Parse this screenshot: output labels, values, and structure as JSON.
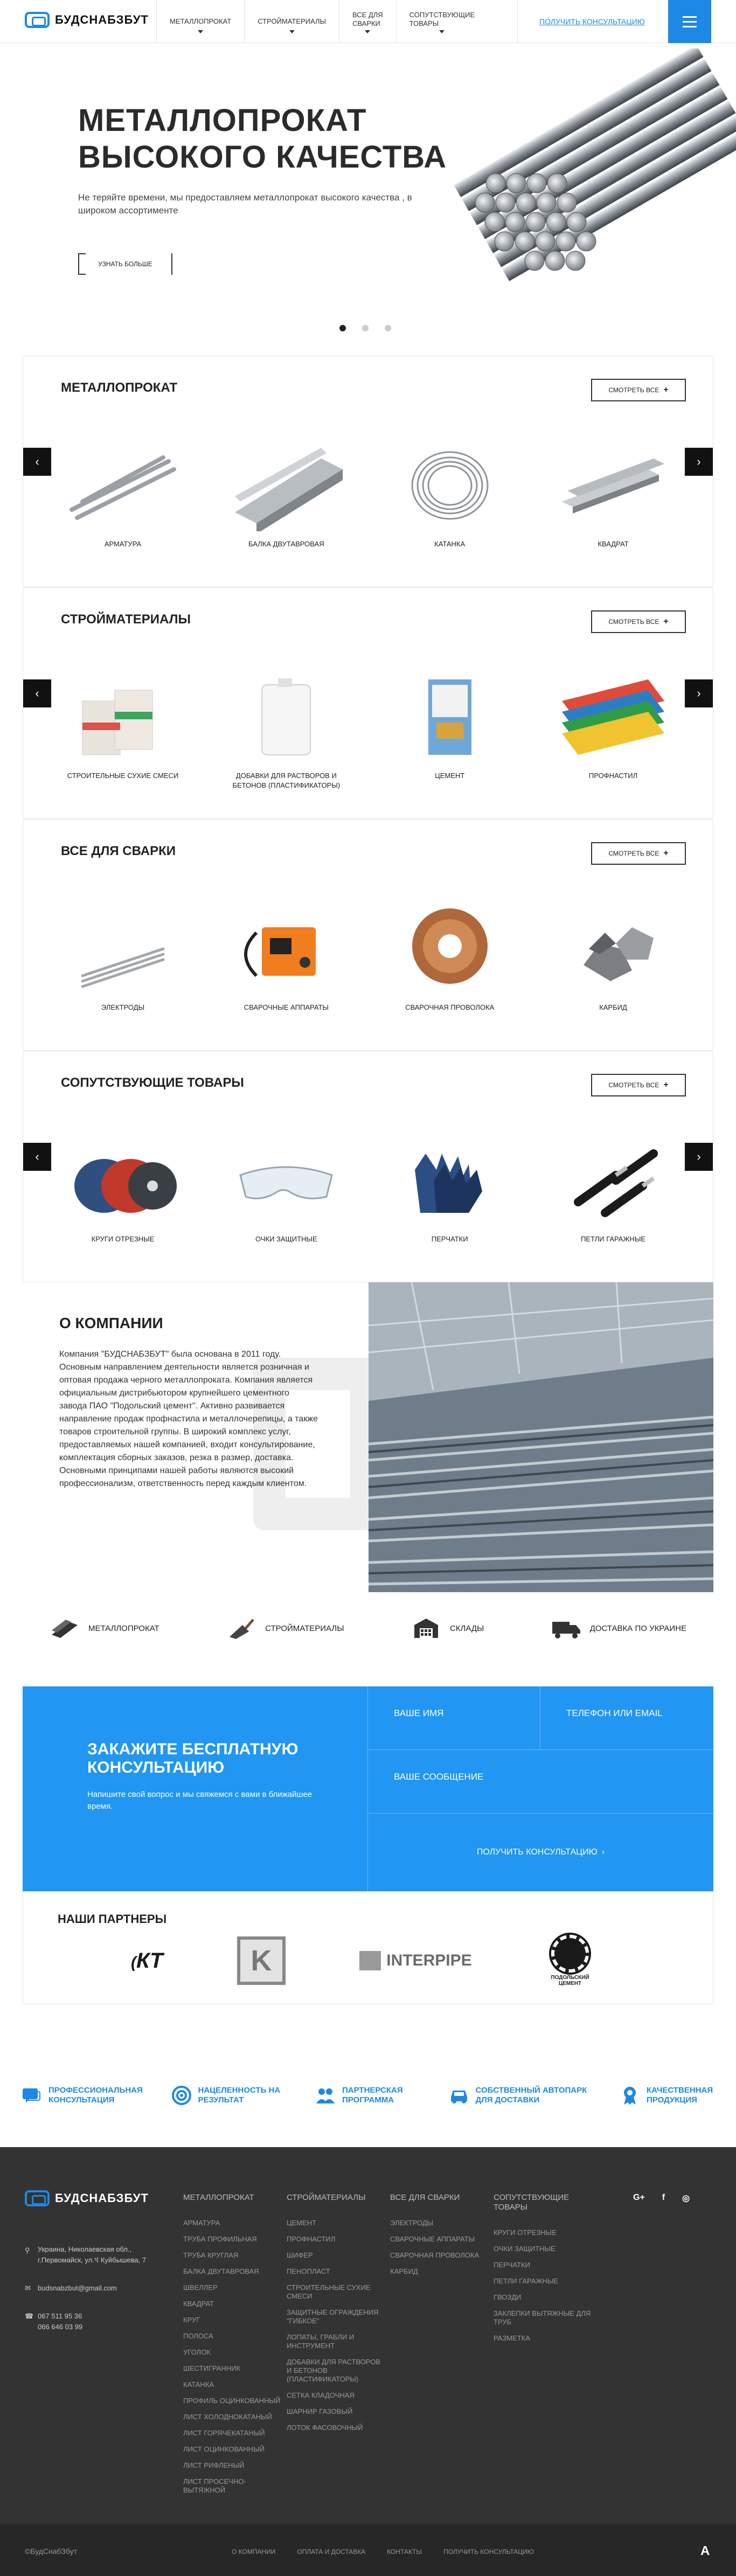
{
  "header": {
    "logo": "БУДСНАБЗБУТ",
    "nav": [
      "МЕТАЛЛОПРОКАТ",
      "СТРОЙМАТЕРИАЛЫ",
      "ВСЕ ДЛЯ\nСВАРКИ",
      "СОПУТСТВУЮЩИЕ\nТОВАРЫ"
    ],
    "consult": "ПОЛУЧИТЬ КОНСУЛЬТАЦИЮ"
  },
  "hero": {
    "title_line1": "МЕТАЛЛОПРОКАТ",
    "title_line2": "ВЫСОКОГО КАЧЕСТВА",
    "subtitle": "Не теряйте времени, мы предоставляем металлопрокат высокого качества , в широком ассортименте",
    "button": "УЗНАТЬ БОЛЬШЕ",
    "slides": 3,
    "active_slide": 1
  },
  "see_all": "СМОТРЕТЬ ВСЕ",
  "categories": [
    {
      "title": "МЕТАЛЛОПРОКАТ",
      "products": [
        "АРМАТУРА",
        "БАЛКА ДВУТАВРОВАЯ",
        "КАТАНКА",
        "КВАДРАТ"
      ]
    },
    {
      "title": "СТРОЙМАТЕРИАЛЫ",
      "products": [
        "СТРОИТЕЛЬНЫЕ СУХИЕ СМЕСИ",
        "ДОБАВКИ ДЛЯ РАСТВОРОВ И БЕТОНОВ (ПЛАСТИФИКАТОРЫ)",
        "ЦЕМЕНТ",
        "ПРОФНАСТИЛ"
      ]
    },
    {
      "title": "ВСЕ ДЛЯ СВАРКИ",
      "products": [
        "ЭЛЕКТРОДЫ",
        "СВАРОЧНЫЕ АППАРАТЫ",
        "СВАРОЧНАЯ ПРОВОЛОКА",
        "КАРБИД"
      ]
    },
    {
      "title": "СОПУТСТВУЮЩИЕ ТОВАРЫ",
      "products": [
        "КРУГИ ОТРЕЗНЫЕ",
        "ОЧКИ ЗАЩИТНЫЕ",
        "ПЕРЧАТКИ",
        "ПЕТЛИ ГАРАЖНЫЕ"
      ]
    }
  ],
  "about": {
    "title": "О КОМПАНИИ",
    "text": "Компания \"БУДСНАБЗБУТ\" была основана в 2011 году. Основным направлением деятельности является розничная и оптовая продажа черного металлопроката. Компания является официальным дистрибьютором крупнейшего цементного завода ПАО \"Подольский цемент\". Активно развивается направление продаж профнастила и металлочерепицы, а также товаров строительной группы. В широкий комплекс услуг, предоставляемых нашей компанией, входит консультирование, комплектация сборных заказов, резка в размер, доставка. Основными принципами нашей работы являются высокий профессионализм, ответственность перед каждым клиентом."
  },
  "features": [
    "МЕТАЛЛОПРОКАТ",
    "СТРОЙМАТЕРИАЛЫ",
    "СКЛАДЫ",
    "ДОСТАВКА ПО УКРАИНЕ"
  ],
  "form": {
    "title": "ЗАКАЖИТЕ БЕСПЛАТНУЮ КОНСУЛЬТАЦИЮ",
    "subtitle": "Напишите свой вопрос и мы свяжемся с вами в ближайшее время.",
    "name_placeholder": "ВАШЕ ИМЯ",
    "contact_placeholder": "ТЕЛЕФОН ИЛИ EMAIL",
    "message_placeholder": "ВАШЕ СООБЩЕНИЕ",
    "submit": "ПОЛУЧИТЬ КОНСУЛЬТАЦИЮ"
  },
  "partners": {
    "title": "НАШИ ПАРТНЕРЫ",
    "logos": [
      "КТ",
      "K",
      "INTERPIPE",
      "ПОДОЛЬСКИЙ ЦЕМЕНТ"
    ]
  },
  "advantages": [
    "ПРОФЕССИОНАЛЬНАЯ КОНСУЛЬТАЦИЯ",
    "НАЦЕЛЕННОСТЬ НА РЕЗУЛЬТАТ",
    "ПАРТНЕРСКАЯ ПРОГРАММА",
    "СОБСТВЕННЫЙ АВТОПАРК ДЛЯ ДОСТАВКИ",
    "КАЧЕСТВЕННАЯ ПРОДУКЦИЯ"
  ],
  "footer": {
    "logo": "БУДСНАБЗБУТ",
    "address": "Украина, Николаевская обл., г.Первомайск, ул.থ Куйбышева, 7",
    "email": "budsnabzbut@gmail.com",
    "phone1": "067 511 95 36",
    "phone2": "066 646 03 99",
    "columns": [
      {
        "title": "МЕТАЛЛОПРОКАТ",
        "items": [
          "АРМАТУРА",
          "ТРУБА ПРОФИЛЬНАЯ",
          "ТРУБА КРУГЛАЯ",
          "БАЛКА ДВУТАВРОВАЯ",
          "ШВЕЛЛЕР",
          "КВАДРАТ",
          "КРУГ",
          "ПОЛОСА",
          "УГОЛОК",
          "ШЕСТИГРАННИК",
          "КАТАНКА",
          "ПРОФИЛЬ ОЦИНКОВАННЫЙ",
          "ЛИСТ ХОЛОДНОКАТАНЫЙ",
          "ЛИСТ ГОРЯЧЕКАТАНЫЙ",
          "ЛИСТ ОЦИНКОВАННЫЙ",
          "ЛИСТ РИФЛЕНЫЙ",
          "ЛИСТ ПРОСЕЧНО-ВЫТЯЖНОЙ"
        ]
      },
      {
        "title": "СТРОЙМАТЕРИАЛЫ",
        "items": [
          "ЦЕМЕНТ",
          "ПРОФНАСТИЛ",
          "ШИФЕР",
          "ПЕНОПЛАСТ",
          "СТРОИТЕЛЬНЫЕ СУХИЕ СМЕСИ",
          "ЗАЩИТНЫЕ ОГРАЖДЕНИЯ \"ГИБКОЕ\"",
          "ЛОПАТЫ, ГРАБЛИ И ИНСТРУМЕНТ",
          "ДОБАВКИ ДЛЯ РАСТВОРОВ И БЕТОНОВ (ПЛАСТИФИКАТОРЫ)",
          "СЕТКА КЛАДОЧНАЯ",
          "ШАРНИР ГАЗОВЫЙ",
          "ЛОТОК ФАСОВОЧНЫЙ"
        ]
      },
      {
        "title": "ВСЕ ДЛЯ СВАРКИ",
        "items": [
          "ЭЛЕКТРОДЫ",
          "СВАРОЧНЫЕ АППАРАТЫ",
          "СВАРОЧНАЯ ПРОВОЛОКА",
          "КАРБИД"
        ]
      },
      {
        "title": "СОПУТСТВУЮЩИЕ ТОВАРЫ",
        "items": [
          "КРУГИ ОТРЕЗНЫЕ",
          "ОЧКИ ЗАЩИТНЫЕ",
          "ПЕРЧАТКИ",
          "ПЕТЛИ ГАРАЖНЫЕ",
          "ГВОЗДИ",
          "ЗАКЛЕПКИ ВЫТЯЖНЫЕ ДЛЯ ТРУБ",
          "РАЗМЕТКА"
        ]
      }
    ],
    "social": [
      "G+",
      "f",
      "◎"
    ],
    "copyright": "©БудСнабЗбут",
    "bottom_links": [
      "О КОМПАНИИ",
      "ОПЛАТА И ДОСТАВКА",
      "КОНТАКТЫ",
      "ПОЛУЧИТЬ КОНСУЛЬТАЦИЮ"
    ],
    "font_toggle": "A"
  },
  "colors": {
    "accent": "#1e88e5",
    "form_bg": "#2196f3",
    "footer_bg": "#333333"
  }
}
